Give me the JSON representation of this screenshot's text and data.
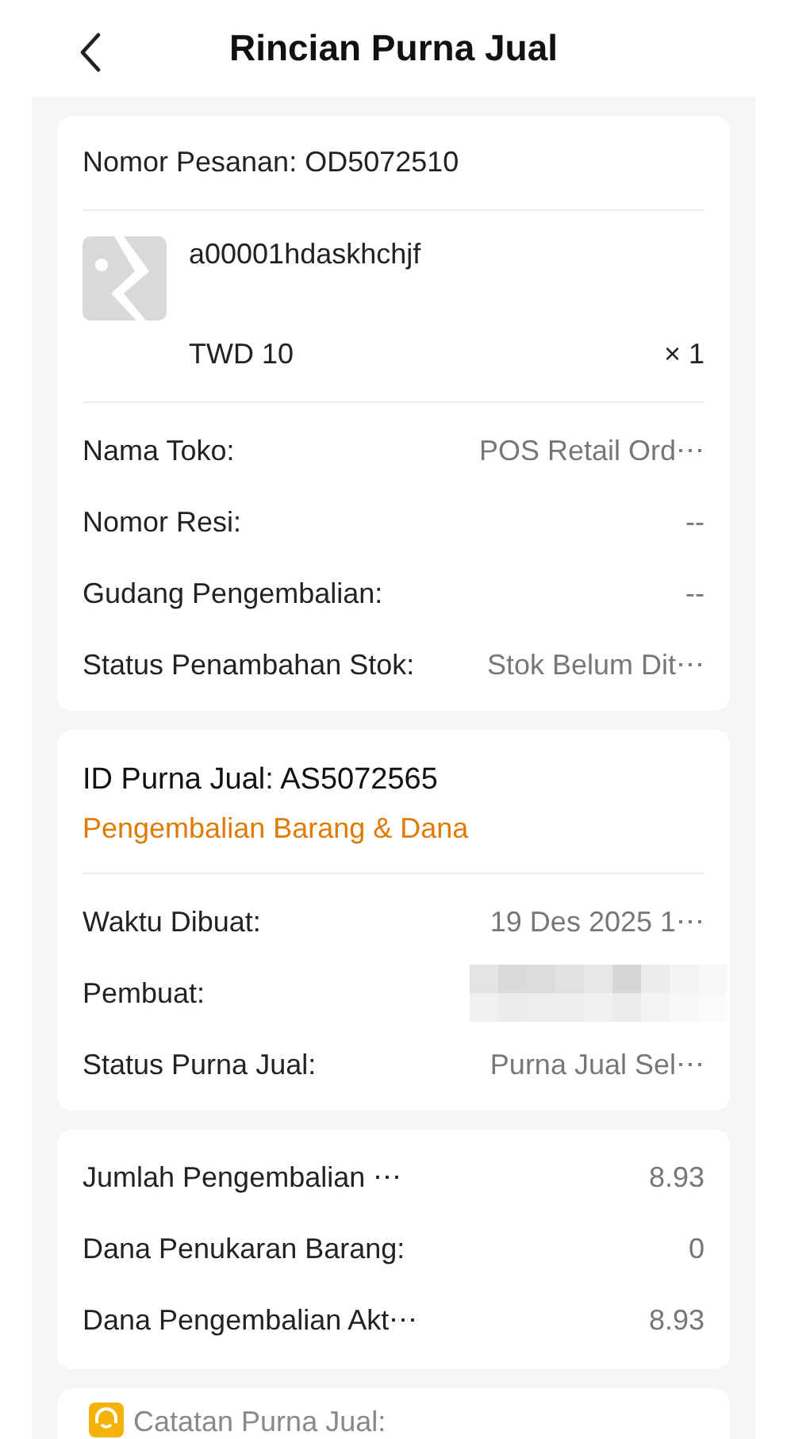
{
  "header": {
    "title": "Rincian Purna Jual"
  },
  "order": {
    "label": "Nomor Pesanan: OD5072510",
    "product": {
      "name": "a00001hdaskhchjf",
      "price": "TWD 10",
      "quantity": "× 1"
    },
    "rows": [
      {
        "label": "Nama Toko:",
        "value": "POS Retail Ord⋯"
      },
      {
        "label": "Nomor Resi:",
        "value": "--"
      },
      {
        "label": "Gudang Pengembalian:",
        "value": "--"
      },
      {
        "label": "Status Penambahan Stok:",
        "value": "Stok Belum Dit⋯"
      }
    ]
  },
  "after_sale": {
    "label": "ID Purna Jual: AS5072565",
    "type": "Pengembalian Barang & Dana",
    "rows": [
      {
        "label": "Waktu Dibuat:",
        "value": "19 Des 2025 1⋯",
        "kind": "text"
      },
      {
        "label": "Pembuat:",
        "kind": "redacted"
      },
      {
        "label": "Status Purna Jual:",
        "value": "Purna Jual Sel⋯",
        "kind": "text"
      }
    ]
  },
  "amounts": {
    "rows": [
      {
        "label": "Jumlah Pengembalian ⋯",
        "value": "8.93"
      },
      {
        "label": "Dana Penukaran Barang:",
        "value": "0"
      },
      {
        "label": "Dana Pengembalian Akt⋯",
        "value": "8.93"
      }
    ]
  },
  "notes": {
    "label": "Catatan Purna Jual:"
  }
}
